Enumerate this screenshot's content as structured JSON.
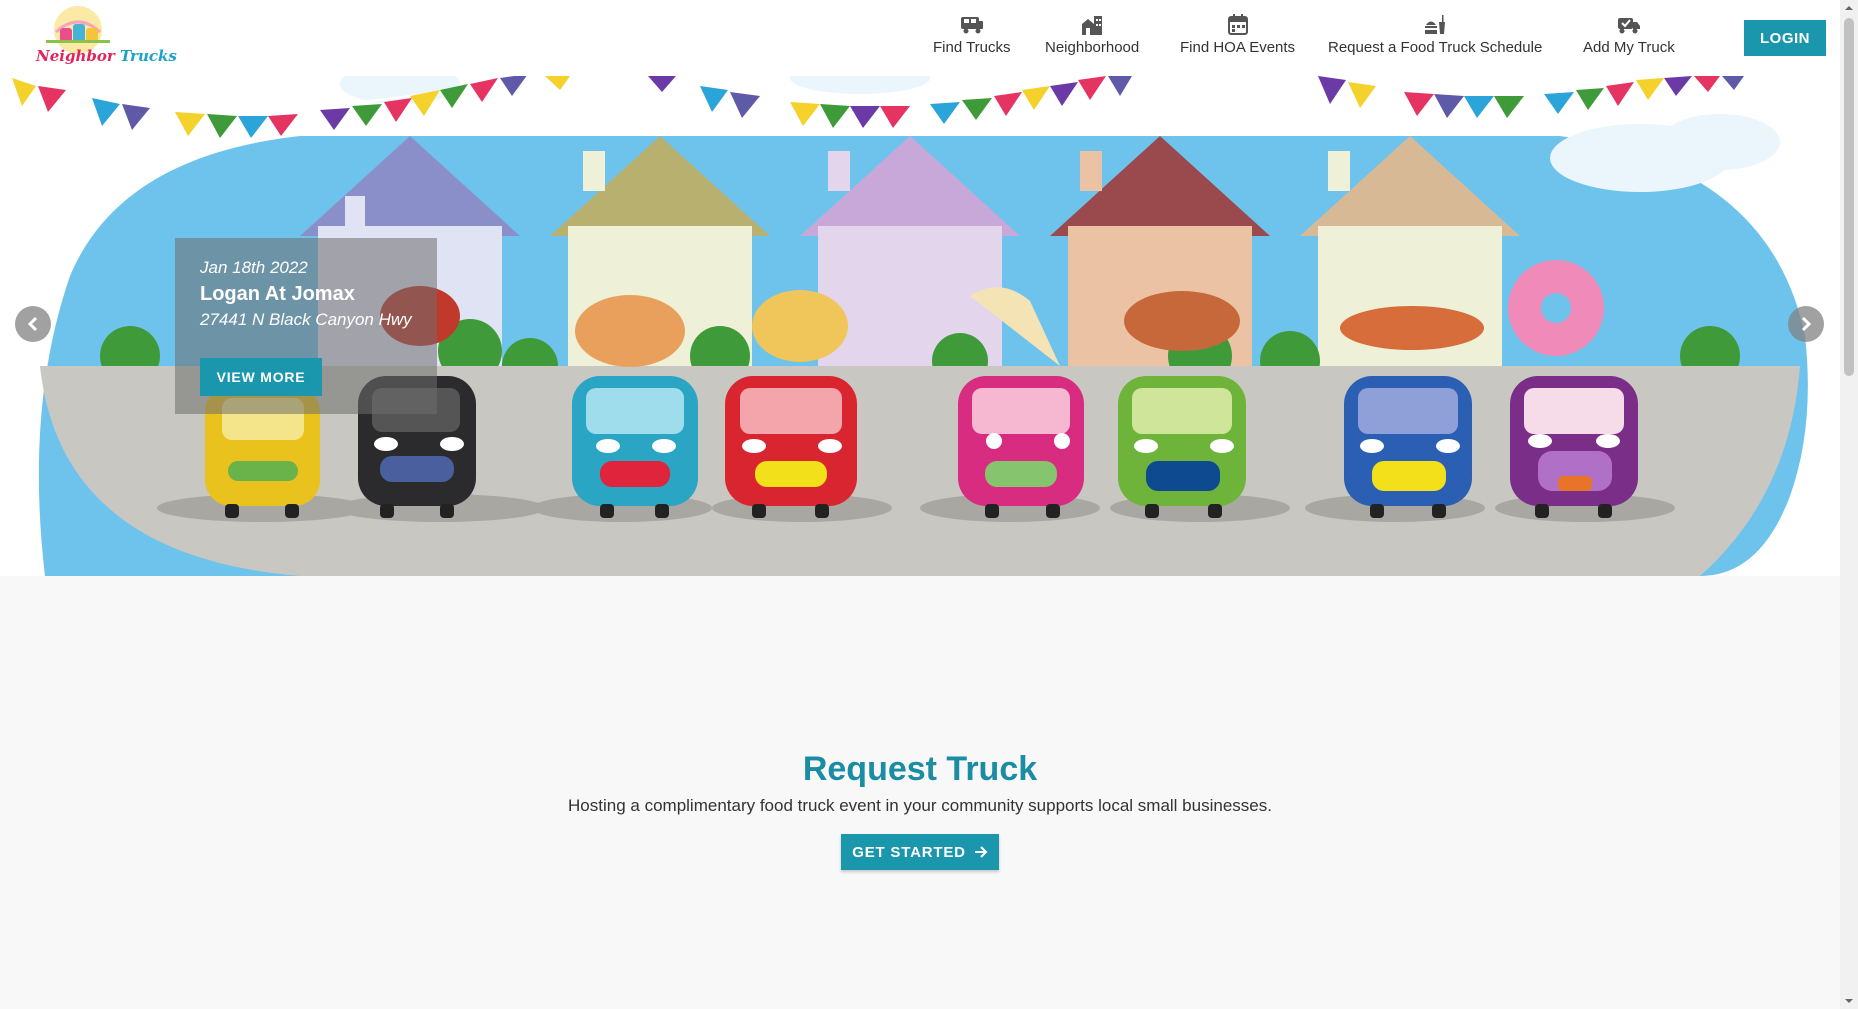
{
  "brand": {
    "name_part1": "Neighbor",
    "name_part2": "Trucks"
  },
  "nav": {
    "items": [
      {
        "label": "Find Trucks",
        "icon": "truck-icon"
      },
      {
        "label": "Neighborhood",
        "icon": "building-icon"
      },
      {
        "label": "Find HOA Events",
        "icon": "calendar-icon"
      },
      {
        "label": "Request a Food Truck Schedule",
        "icon": "food-drink-icon"
      },
      {
        "label": "Add My Truck",
        "icon": "truck-check-icon"
      }
    ],
    "login_label": "LOGIN"
  },
  "hero": {
    "event_date": "Jan 18th 2022",
    "event_title": "Logan At Jomax",
    "event_address": "27441 N Black Canyon Hwy",
    "view_more_label": "VIEW MORE",
    "prev_icon": "chevron-left-icon",
    "next_icon": "chevron-right-icon"
  },
  "request_section": {
    "title": "Request Truck",
    "description": "Hosting a complimentary food truck event in your community supports local small businesses.",
    "button_label": "GET STARTED",
    "button_icon": "arrow-right-icon"
  },
  "colors": {
    "accent": "#1a97ad",
    "title": "#1a8ca3",
    "sky": "#6ec3ec",
    "road": "#c8c7c2"
  }
}
